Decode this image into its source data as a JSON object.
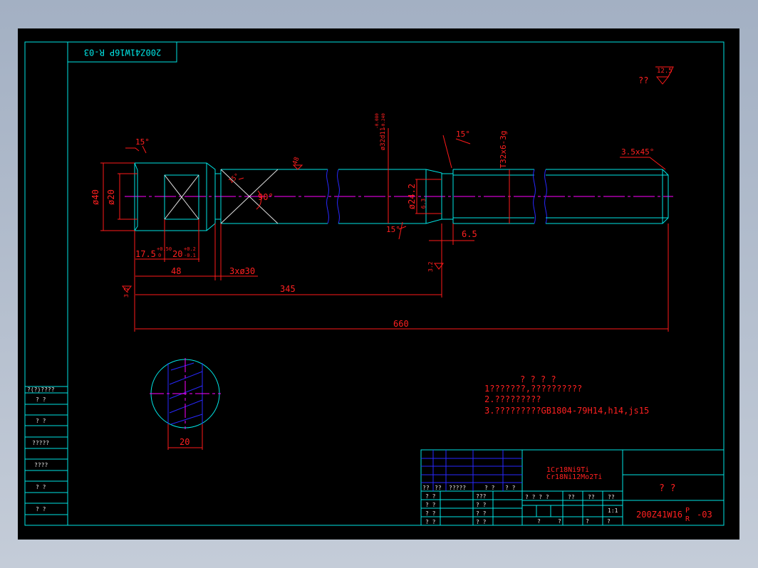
{
  "drawing": {
    "stamp_code": "200Z41W16P R-03",
    "roughness_note": "??",
    "roughness_value": "12.5"
  },
  "dimensions": {
    "angle_15_top": "15°",
    "angle_15_right": "15°",
    "angle_15_bottom": "15°",
    "dia_40": "ø40",
    "dia_20": "ø20",
    "angle_90": "90°",
    "roughness_48": "48",
    "dia_32": "ø32d11",
    "dia_32_tol_upper": "-0.080",
    "dia_32_tol_lower": "-0.240",
    "dia_24": "ø24.2",
    "dia_24_rough": "6.3",
    "thread": "T32x6-3g",
    "chamfer": "3.5x45°",
    "len_17_5": "17.5",
    "len_17_5_tol_upper": "+0.50",
    "len_17_5_tol_lower": "0",
    "len_20": "20",
    "len_20_tol_upper": "+0.2",
    "len_20_tol_lower": "-0.1",
    "len_48": "48",
    "holes": "3xø30",
    "len_345": "345",
    "len_660": "660",
    "len_6_5": "6.5",
    "rough_left": "3.2",
    "rough_mid": "3.2",
    "section_20": "20"
  },
  "notes": {
    "heading": "? ? ? ?",
    "line1": "1???????,??????????",
    "line2": "2.?????????",
    "line3": "3.?????????GB1804-79H14,h14,js15"
  },
  "left_table": {
    "rows": [
      "?(?)????",
      "?  ?",
      "?  ?",
      "?????",
      "????",
      "?  ?",
      "?  ?"
    ]
  },
  "title_block": {
    "material_line1": "1Cr18Ni9Ti",
    "material_line2": "Cr18Ni12Mo2Ti",
    "header_row": [
      "??",
      "??",
      "?????",
      "?  ?",
      "?  ?"
    ],
    "rows_left": [
      "?  ?",
      "?  ?",
      "?  ?",
      "?  ?"
    ],
    "rows_mid": [
      "???",
      "?  ?",
      "?  ?",
      "?  ?"
    ],
    "stage_labels": [
      "?  ?  ?  ?",
      "??",
      "??",
      "??"
    ],
    "scale": "1:1",
    "bottom_labels": [
      "?",
      "?",
      "?",
      "?"
    ],
    "part_name": "?    ?",
    "code_prefix": "200Z41W16",
    "code_sup": "P",
    "code_sub": "R",
    "code_suffix": "-03"
  },
  "colors": {
    "outline": "#00e5e5",
    "dimension": "#ff1a1a",
    "centerline": "#ff00ff",
    "text": "#e8e8e8",
    "grid_lines": "#2828ff"
  }
}
